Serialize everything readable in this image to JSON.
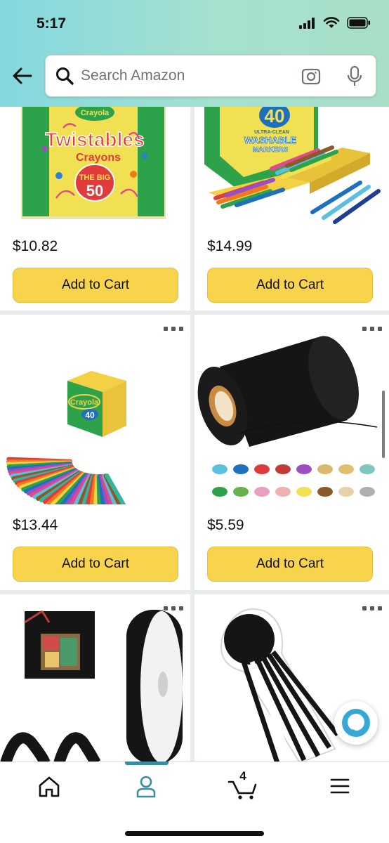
{
  "status_bar": {
    "time": "5:17"
  },
  "search": {
    "placeholder": "Search Amazon"
  },
  "products": [
    {
      "price": "$10.82",
      "button": "Add to Cart",
      "image": "crayola-twistables-crayons-image",
      "box_text_1": "Crayola",
      "box_text_2": "Twistables",
      "box_text_3": "Crayons",
      "box_text_4": "THE BIG",
      "box_text_5": "50"
    },
    {
      "price": "$14.99",
      "button": "Add to Cart",
      "image": "crayola-washable-markers-image",
      "box_text_1": "40",
      "box_text_2": "ULTRA-CLEAN",
      "box_text_3": "WASHABLE",
      "box_text_4": "MARKERS"
    },
    {
      "price": "$13.44",
      "button": "Add to Cart",
      "image": "crayola-markers-fan-image",
      "box_text_1": "Crayola",
      "box_text_2": "40"
    },
    {
      "price": "$5.59",
      "button": "Add to Cart",
      "image": "black-cotton-twine-image"
    },
    {
      "image": "black-ribbon-spool-image"
    },
    {
      "image": "black-white-tassel-image"
    }
  ],
  "nav": {
    "cart_count": "4"
  },
  "colors": {
    "accent": "#3a8ca0",
    "button": "#f7d44b",
    "header_start": "#84d8e0",
    "header_end": "#a8dfc7"
  }
}
